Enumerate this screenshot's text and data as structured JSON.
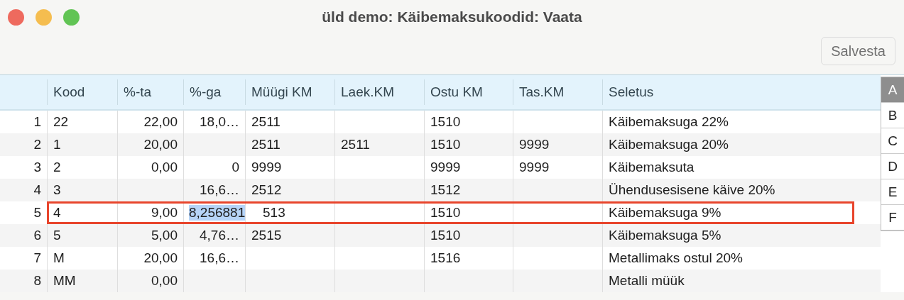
{
  "window": {
    "title": "üld demo: Käibemaksukoodid: Vaata"
  },
  "toolbar": {
    "save_button": {
      "label": "Salvesta",
      "disabled": true
    }
  },
  "table": {
    "columns": [
      "Kood",
      "%-ta",
      "%-ga",
      "Müügi KM",
      "Laek.KM",
      "Ostu KM",
      "Tas.KM",
      "Seletus"
    ],
    "rows": [
      {
        "number": "1",
        "selected": false,
        "cells": [
          "22",
          "22,00",
          "18,0…",
          "2511",
          "",
          "1510",
          "",
          "Käibemaksuga 22%"
        ]
      },
      {
        "number": "2",
        "selected": false,
        "cells": [
          "1",
          "20,00",
          "",
          "2511",
          "2511",
          "1510",
          "9999",
          "Käibemaksuga 20%"
        ]
      },
      {
        "number": "3",
        "selected": false,
        "cells": [
          "2",
          "0,00",
          "0",
          "9999",
          "",
          "9999",
          "9999",
          "Käibemaksuta"
        ]
      },
      {
        "number": "4",
        "selected": false,
        "cells": [
          "3",
          "",
          "16,6…",
          "2512",
          "",
          "1512",
          "",
          "Ühendusesisene käive 20%"
        ]
      },
      {
        "number": "5",
        "selected": true,
        "editing_value": "8,256881",
        "cells": [
          "4",
          "9,00",
          "",
          "513",
          "",
          "1510",
          "",
          "Käibemaksuga 9%"
        ]
      },
      {
        "number": "6",
        "selected": false,
        "cells": [
          "5",
          "5,00",
          "4,76…",
          "2515",
          "",
          "1510",
          "",
          "Käibemaksuga 5%"
        ]
      },
      {
        "number": "7",
        "selected": false,
        "cells": [
          "M",
          "20,00",
          "16,6…",
          "",
          "",
          "1516",
          "",
          "Metallimaks ostul 20%"
        ]
      },
      {
        "number": "8",
        "selected": false,
        "cells": [
          "MM",
          "0,00",
          "",
          "",
          "",
          "",
          "",
          "Metalli müük"
        ]
      }
    ]
  },
  "index_bar": [
    {
      "label": "A",
      "selected": true
    },
    {
      "label": "B",
      "selected": false
    },
    {
      "label": "C",
      "selected": false
    },
    {
      "label": "D",
      "selected": false
    },
    {
      "label": "E",
      "selected": false
    },
    {
      "label": "F",
      "selected": false
    }
  ]
}
